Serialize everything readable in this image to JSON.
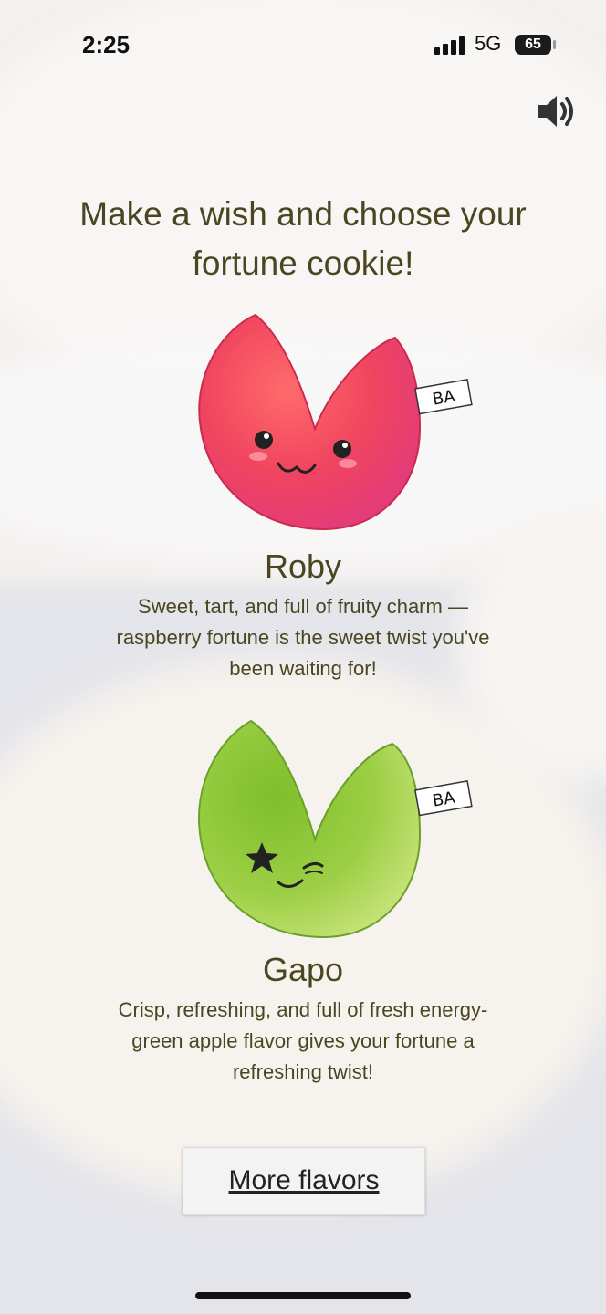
{
  "status_bar": {
    "time": "2:25",
    "network": "5G",
    "battery": "65"
  },
  "header": {
    "title": "Make a wish and choose your fortune cookie!",
    "sound_icon": "speaker-icon"
  },
  "cookies": [
    {
      "name": "Roby",
      "description": "Sweet, tart, and full of fruity charm —raspberry fortune is the sweet twist you've been waiting for!",
      "tag": "BA",
      "color": "#f0455f"
    },
    {
      "name": "Gapo",
      "description": "Crisp, refreshing, and full of fresh energy-green apple flavor gives your fortune a refreshing twist!",
      "tag": "BA",
      "color": "#8cc63a"
    }
  ],
  "more_button": {
    "label": "More flavors"
  }
}
